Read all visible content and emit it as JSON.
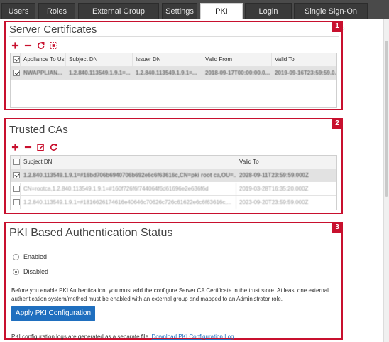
{
  "tabs": [
    {
      "label": "Users",
      "active": false
    },
    {
      "label": "Roles",
      "active": false
    },
    {
      "label": "External Group Mapping",
      "active": false
    },
    {
      "label": "Settings",
      "active": false
    },
    {
      "label": "PKI Settings",
      "active": true
    },
    {
      "label": "Login Banner",
      "active": false
    },
    {
      "label": "Single Sign-On Settings",
      "active": false
    }
  ],
  "colors": {
    "accent": "#1f6fbf",
    "callout": "#c8102e",
    "tabbar": "#4a4a4a"
  },
  "server_certificates": {
    "title": "Server Certificates",
    "callout": "1",
    "toolbar": [
      "add-icon",
      "remove-icon",
      "refresh-icon",
      "view-icon"
    ],
    "columns": [
      "Appliance To Use",
      "Subject DN",
      "Issuer DN",
      "Valid From",
      "Valid To"
    ],
    "rows": [
      {
        "checked": true,
        "cells": [
          "NWAPPLIAN...",
          "1.2.840.113549.1.9.1=...",
          "1.2.840.113549.1.9.1=...",
          "2018-09-17T00:00:00.0...",
          "2019-09-16T23:59:59.0..."
        ]
      }
    ]
  },
  "trusted_cas": {
    "title": "Trusted CAs",
    "callout": "2",
    "toolbar": [
      "add-icon",
      "remove-icon",
      "edit-icon",
      "refresh-icon"
    ],
    "columns": [
      "Subject DN",
      "Valid To"
    ],
    "rows": [
      {
        "checked": true,
        "selected": true,
        "cells": [
          "1.2.840.113549.1.9.1=#16bd706b6940706b692e6c6f63616c,CN=pki root ca,OU=...",
          "2028-09-11T23:59:59.000Z"
        ]
      },
      {
        "checked": false,
        "selected": false,
        "cells": [
          "CN=rootca,1.2.840.113549.1.9.1=#160f726f6f744064f6d61696e2e636f6d",
          "2019-03-28T16:35:20.000Z"
        ]
      },
      {
        "checked": false,
        "selected": false,
        "cells": [
          "1.2.840.113549.1.9.1=#1816626174616e40646c70626c726c61622e6c6f63616c,...",
          "2023-09-20T23:59:59.000Z"
        ]
      }
    ]
  },
  "pki_status": {
    "title": "PKI Based Authentication Status",
    "callout": "3",
    "options": [
      {
        "label": "Enabled",
        "selected": false
      },
      {
        "label": "Disabled",
        "selected": true
      }
    ],
    "description": "Before you enable PKI Authentication, you must add the configure Server CA Certificate in the trust store. At least one external authentication system/method must be enabled with an external group and mapped to an Administrator role.",
    "apply_button": "Apply PKI Configuration",
    "log_note": "PKI configuration logs are generated as a separate file.",
    "log_link": "Download PKI Configuration Log"
  }
}
